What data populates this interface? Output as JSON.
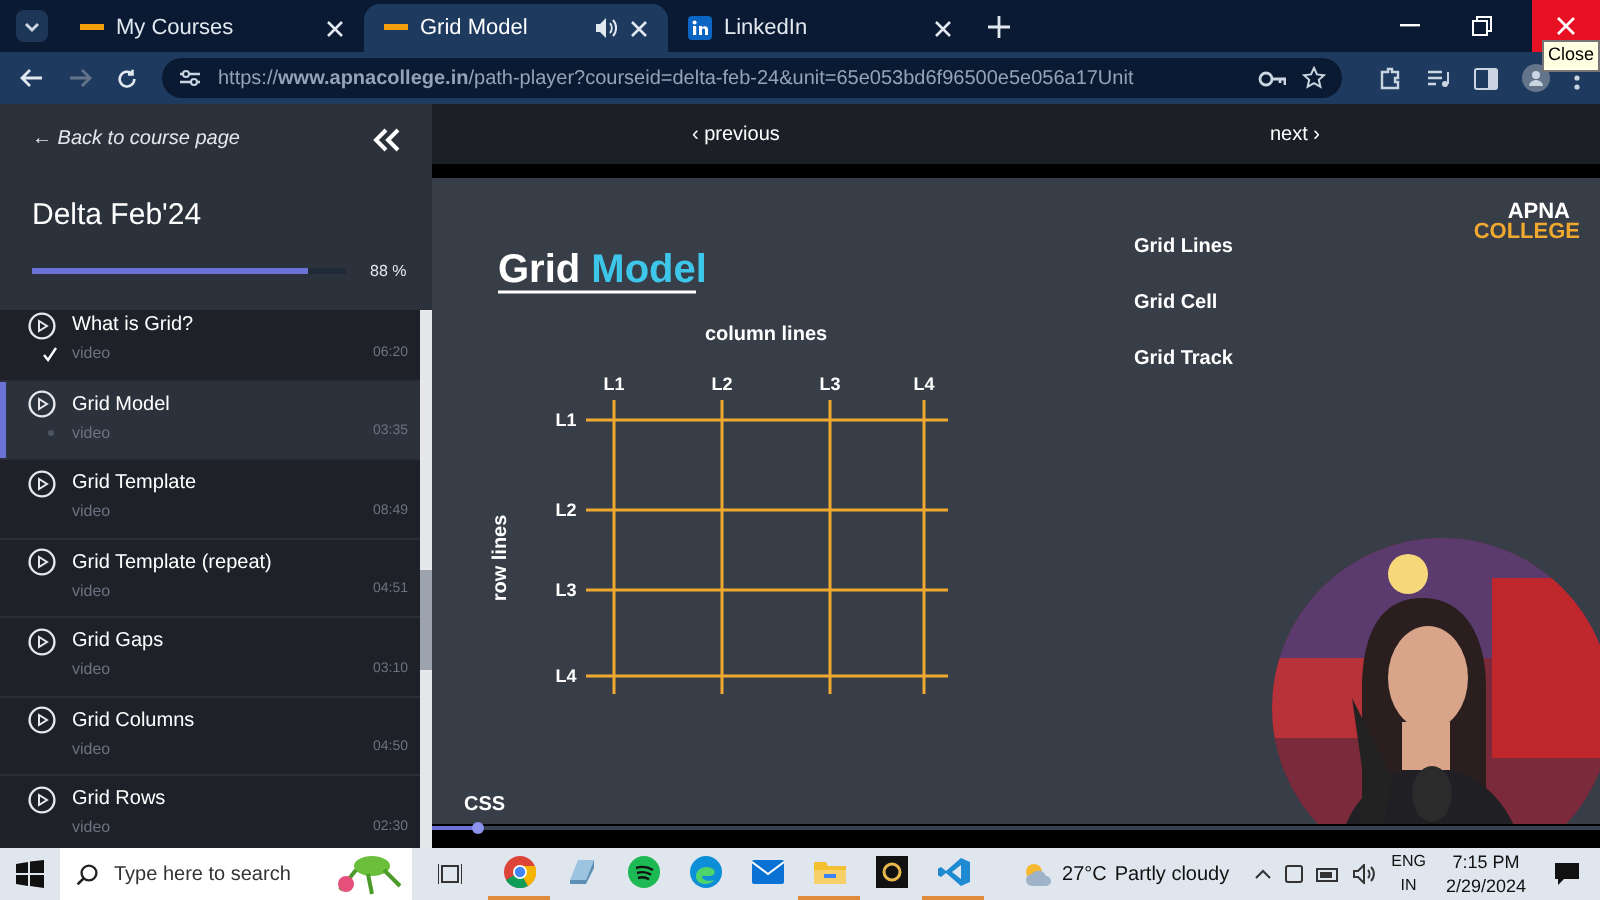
{
  "browser": {
    "tabs": [
      {
        "label": "My Courses",
        "selected": false,
        "audio": false
      },
      {
        "label": "Grid Model",
        "selected": true,
        "audio": true
      },
      {
        "label": "LinkedIn",
        "selected": false,
        "audio": false
      }
    ],
    "tooltip": "Close",
    "url": "https://**www.apnacollege.in**/path-player?courseid=delta-feb-24&unit=65e053bd6f96500e5e056a17Unit"
  },
  "sidebar": {
    "back_link": "← Back to course page",
    "course_title": "Delta Feb'24",
    "progress": {
      "level": 0.88,
      "reading": "88 %"
    },
    "items": [
      {
        "title": "What is Grid?",
        "type": "video",
        "duration": "06:20",
        "selected": false,
        "completed": true
      },
      {
        "title": "Grid Model",
        "type": "video",
        "duration": "03:35",
        "selected": true,
        "completed": false
      },
      {
        "title": "Grid Template",
        "type": "video",
        "duration": "08:49",
        "selected": false,
        "completed": false
      },
      {
        "title": "Grid Template (repeat)",
        "type": "video",
        "duration": "04:51",
        "selected": false,
        "completed": false
      },
      {
        "title": "Grid Gaps",
        "type": "video",
        "duration": "03:10",
        "selected": false,
        "completed": false
      },
      {
        "title": "Grid Columns",
        "type": "video",
        "duration": "04:50",
        "selected": false,
        "completed": false
      },
      {
        "title": "Grid Rows",
        "type": "video",
        "duration": "02:30",
        "selected": false,
        "completed": false
      }
    ]
  },
  "player": {
    "previous": "‹ previous",
    "next": "next ›",
    "slide": {
      "title": "Grid",
      "title_highlight": "Model",
      "column_caption": "column lines",
      "row_caption": "row lines",
      "column_labels": [
        "L1",
        "L2",
        "L3",
        "L4"
      ],
      "row_labels": [
        "L1",
        "L2",
        "L3",
        "L4"
      ],
      "terms": [
        "Grid Lines",
        "Grid Cell",
        "Grid Track"
      ],
      "logo": [
        "APNA",
        "COLLEGE"
      ],
      "footer": "CSS"
    },
    "seek": {
      "level": 0.04
    }
  },
  "taskbar": {
    "search_placeholder": "Type here to search",
    "apps": [
      {
        "kind": "chrome",
        "open": true
      },
      {
        "kind": "files",
        "open": false
      },
      {
        "kind": "spotify",
        "open": false
      },
      {
        "kind": "edge",
        "open": false
      },
      {
        "kind": "mail",
        "open": false
      },
      {
        "kind": "folder",
        "open": true
      },
      {
        "kind": "app",
        "open": false
      },
      {
        "kind": "vscode",
        "open": true
      }
    ],
    "weather": {
      "temp": "27°C",
      "condition": "Partly cloudy"
    },
    "language": [
      "ENG",
      "IN"
    ],
    "time": "7:15 PM",
    "date": "2/29/2024"
  }
}
